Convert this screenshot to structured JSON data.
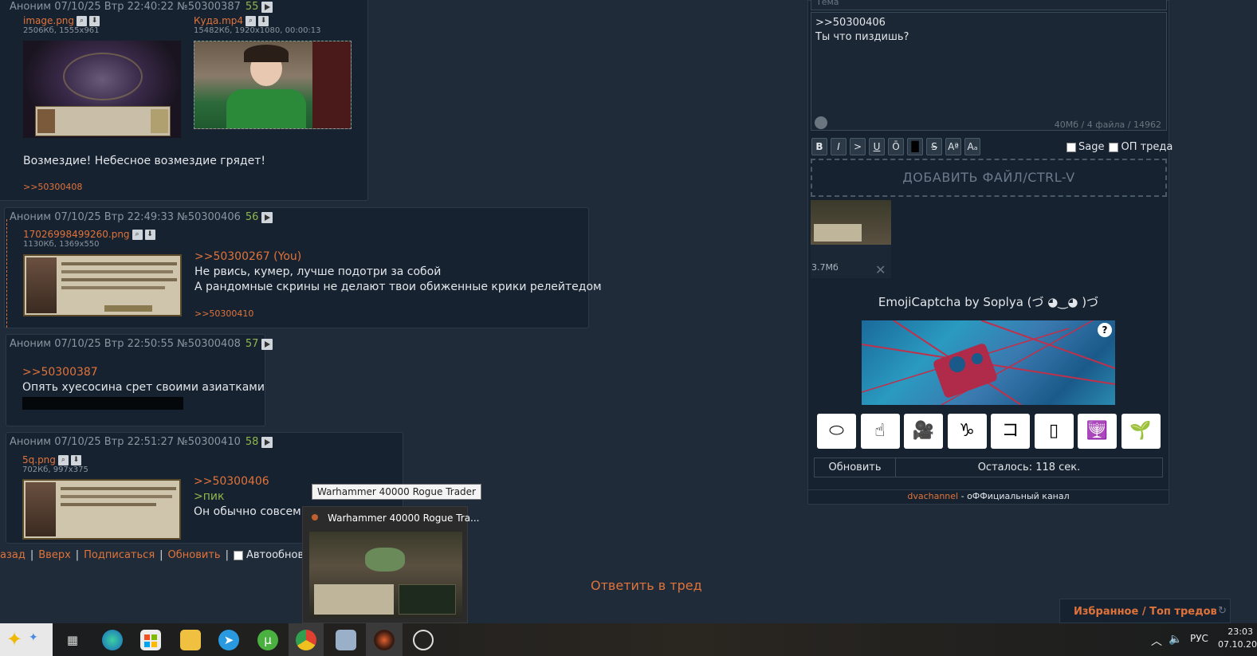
{
  "posts": [
    {
      "author": "Аноним",
      "datetime": "07/10/25 Втр 22:40:22",
      "number": "№50300387",
      "index": "55",
      "files": [
        {
          "name": "image.png",
          "meta": "2506Кб, 1555x961"
        },
        {
          "name": "Куда.mp4",
          "meta": "15482Кб, 1920x1080, 00:00:13"
        }
      ],
      "text": "Возмездие! Небесное возмездие грядет!",
      "replies": ">>50300408"
    },
    {
      "author": "Аноним",
      "datetime": "07/10/25 Втр 22:49:33",
      "number": "№50300406",
      "index": "56",
      "files": [
        {
          "name": "17026998499260.png",
          "meta": "1130Кб, 1369x550"
        }
      ],
      "reply_ref": ">>50300267 (You)",
      "lines": [
        "Не рвись, кумер, лучше подотри за собой",
        "А рандомные скрины не делают твои обиженные крики релейтедом"
      ],
      "replies": ">>50300410"
    },
    {
      "author": "Аноним",
      "datetime": "07/10/25 Втр 22:50:55",
      "number": "№50300408",
      "index": "57",
      "reply_ref": ">>50300387",
      "lines": [
        "Опять хуесосина срет своими азиатками"
      ]
    },
    {
      "author": "Аноним",
      "datetime": "07/10/25 Втр 22:51:27",
      "number": "№50300410",
      "index": "58",
      "files": [
        {
          "name": "5q.png",
          "meta": "702Кб, 997x375"
        }
      ],
      "reply_ref": ">>50300406",
      "greentext": ">пик",
      "lines": [
        "Он обычно совсем д"
      ]
    }
  ],
  "nav": {
    "back": "азад",
    "sep": "|",
    "up": "Вверх",
    "subscribe": "Подписаться",
    "refresh": "Обновить",
    "autorefresh": "Автообновление"
  },
  "reply_thread": "Ответить в тред",
  "form": {
    "subject_placeholder": "Тема",
    "message_lines": [
      ">>50300406",
      "Ты что пиздишь?"
    ],
    "limits": "40Мб / 4 файла / 14962",
    "buttons": [
      "B",
      "I",
      ">",
      "U",
      "Ō",
      "█",
      "S",
      "Aª",
      "Aₐ"
    ],
    "sage_label": "Sage",
    "op_label": "ОП треда",
    "add_file": "ДОБАВИТЬ ФАЙЛ/CTRL-V",
    "attached_size": "3.7Мб",
    "captcha_title": "EmojiCaptcha by Soplya (づ ◕‿◕ )づ",
    "captcha_help": "?",
    "emoji_icons": [
      "portal-icon",
      "hand-icon",
      "video-camera-icon",
      "capricorn-icon",
      "kanji-icon",
      "mahjong-icon",
      "menorah-icon",
      "sprout-icon"
    ],
    "emoji_glyphs": [
      "⬭",
      "☝",
      "🎥",
      "♑",
      "コ",
      "▯",
      "🕎",
      "🌱"
    ],
    "refresh_btn": "Обновить",
    "remaining": "Осталось: 118 сек.",
    "footer_link": "dvachannel",
    "footer_text": " - оФФициальный канал"
  },
  "tooltip": "Warhammer 40000 Rogue Trader",
  "preview_title": "Warhammer 40000 Rogue Tra...",
  "favorites": "Избранное / Топ тредов",
  "taskbar": {
    "lang": "РУС",
    "time": "23:03",
    "date": "07.10.20"
  }
}
